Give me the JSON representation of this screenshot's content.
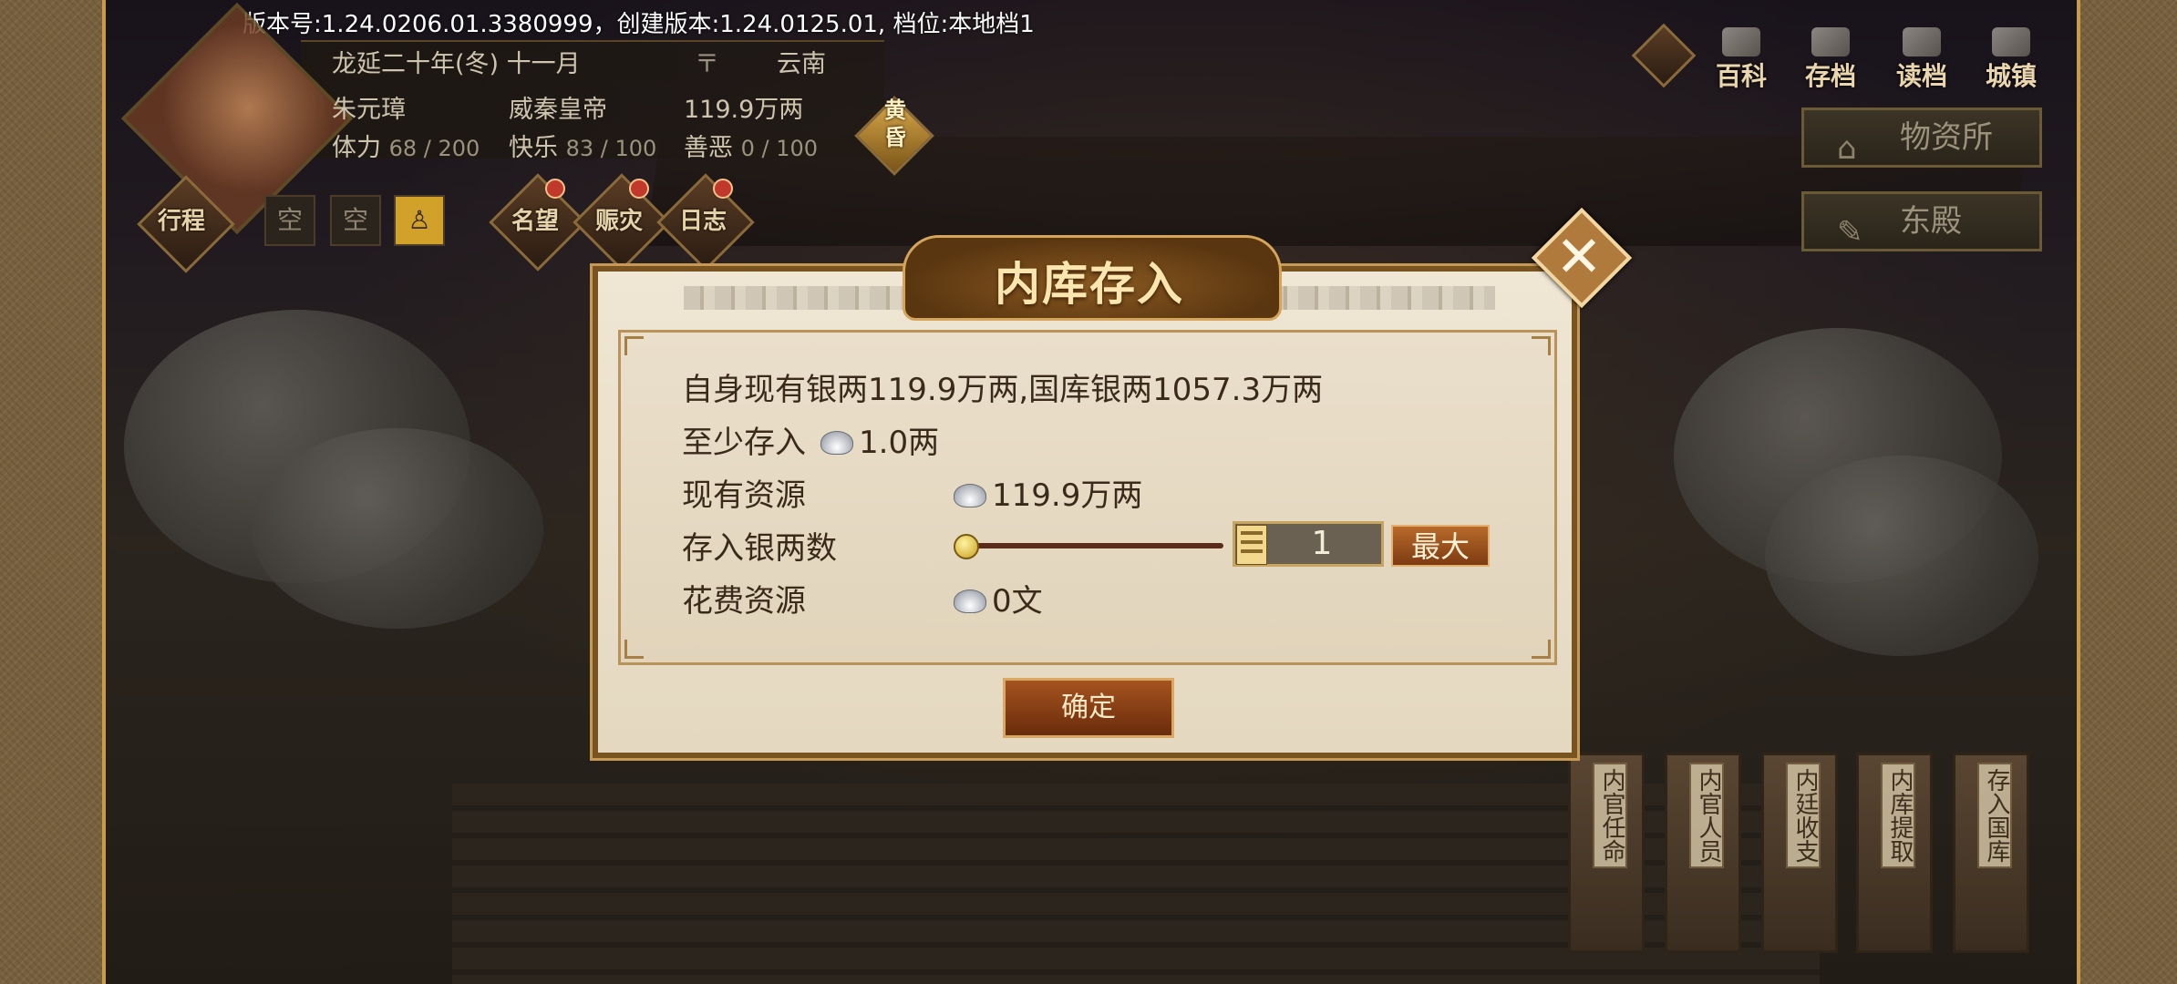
{
  "version_text": "版本号:1.24.0206.01.3380999，创建版本:1.24.0125.01, 档位:本地档1",
  "hud": {
    "date": "龙延二十年(冬) 十一月",
    "location": "云南",
    "name": "朱元璋",
    "title": "威秦皇帝",
    "money": "119.9万两",
    "stamina_label": "体力",
    "stamina_value": "68 / 200",
    "happiness_label": "快乐",
    "happiness_value": "83 / 100",
    "morality_label": "善恶",
    "morality_value": "0 / 100",
    "time_of_day": "黄昏",
    "itinerary": "行程",
    "slots": [
      "空",
      "空"
    ],
    "round_buttons": [
      "名望",
      "赈灾",
      "日志"
    ]
  },
  "top_right": {
    "icons": [
      "百科",
      "存档",
      "读档",
      "城镇"
    ],
    "side_buttons": [
      "物资所",
      "东殿"
    ]
  },
  "bottom_buttons": [
    "内官任命",
    "内官人员",
    "内廷收支",
    "内库提取",
    "存入国库"
  ],
  "dialog": {
    "title": "内库存入",
    "summary": "自身现有银两119.9万两,国库银两1057.3万两",
    "min_label": "至少存入",
    "min_value": "1.0两",
    "current_label": "现有资源",
    "current_value": "119.9万两",
    "deposit_label": "存入银两数",
    "deposit_amount": "1",
    "max_label": "最大",
    "cost_label": "花费资源",
    "cost_value": "0文",
    "confirm_label": "确定",
    "slider_fraction": 0.0
  }
}
